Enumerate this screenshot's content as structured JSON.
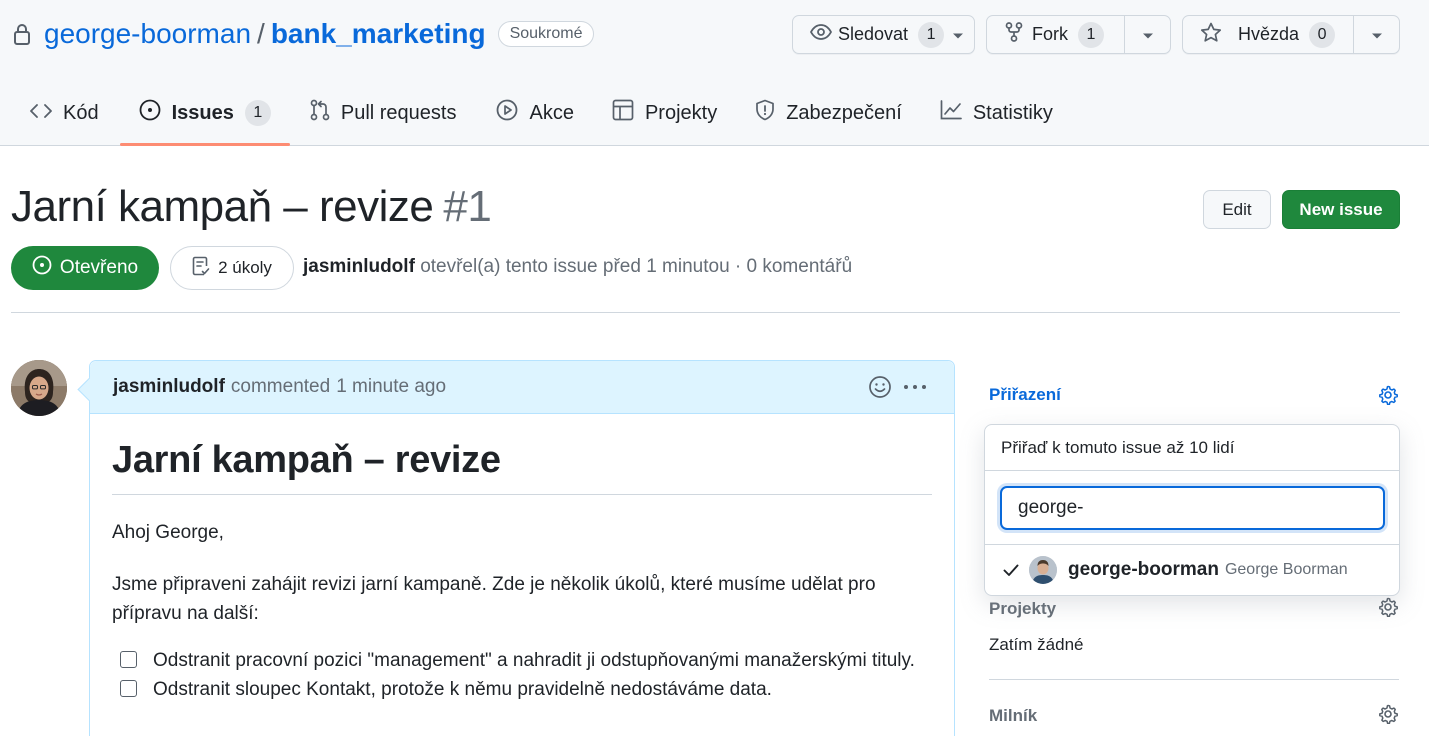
{
  "repo": {
    "owner": "george-boorman",
    "separator": "/",
    "name": "bank_marketing",
    "visibility": "Soukromé",
    "icon": "lock-icon"
  },
  "actions": {
    "watch": {
      "label": "Sledovat",
      "count": "1",
      "icon": "eye-icon"
    },
    "fork": {
      "label": "Fork",
      "count": "1",
      "icon": "repo-forked-icon"
    },
    "star": {
      "label": "Hvězda",
      "count": "0",
      "icon": "star-icon"
    }
  },
  "nav": {
    "code": "Kód",
    "issues": "Issues",
    "issues_count": "1",
    "pulls": "Pull requests",
    "actions": "Akce",
    "projects": "Projekty",
    "security": "Zabezpečení",
    "insights": "Statistiky",
    "selected": "issues"
  },
  "issue": {
    "title": "Jarní kampaň – revize",
    "number": "#1",
    "edit_label": "Edit",
    "new_issue_label": "New issue",
    "state": "Otevřeno",
    "tasks": "2 úkoly",
    "author": "jasminludolf",
    "meta_text": "otevřel(a) tento issue před 1 minutou · 0 komentářů"
  },
  "comment": {
    "author": "jasminludolf",
    "action": "commented",
    "time": "1 minute ago",
    "heading": "Jarní kampaň – revize",
    "greeting": "Ahoj George,",
    "paragraph": "Jsme připraveni zahájit revizi jarní kampaně. Zde je několik úkolů, které musíme udělat pro přípravu na další:",
    "tasks": [
      {
        "text": "Odstranit pracovní pozici \"management\" a nahradit ji odstupňovanými manažerskými tituly.",
        "done": false
      },
      {
        "text": "Odstranit sloupec Kontakt, protože k němu pravidelně nedostáváme data.",
        "done": false
      }
    ]
  },
  "sidebar": {
    "assignees": {
      "heading": "Přiřazení",
      "popover_title": "Přiřaď k tomuto issue až 10 lidí",
      "filter_value": "george-",
      "suggestions": [
        {
          "login": "george-boorman",
          "name": "George Boorman",
          "selected": true
        }
      ]
    },
    "projects": {
      "heading": "Projekty",
      "value": "Zatím žádné"
    },
    "milestone": {
      "heading": "Milník"
    }
  },
  "colors": {
    "accent": "#0969da",
    "success": "#1f883d",
    "tab_underline": "#fd8c73",
    "comment_header": "#ddf4ff"
  }
}
